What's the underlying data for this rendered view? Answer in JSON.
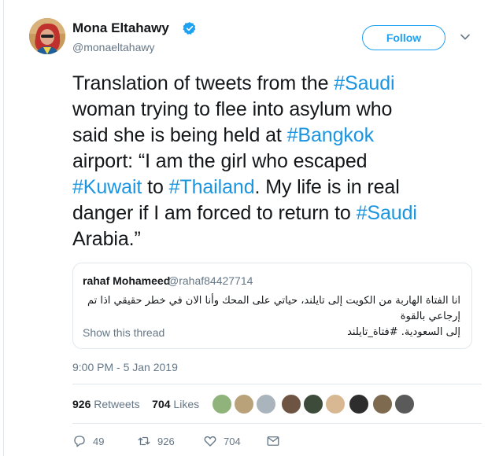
{
  "author": {
    "name": "Mona Eltahawy",
    "handle": "@monaeltahawy",
    "verified_icon": "verified-badge-icon"
  },
  "follow_button": {
    "label": "Follow"
  },
  "tweet": {
    "lines": [
      [
        {
          "t": "Translation of tweets from the "
        },
        {
          "t": "#Saudi",
          "tag": true
        }
      ],
      [
        {
          "t": "woman trying to flee into asylum who"
        }
      ],
      [
        {
          "t": "said she is being held at "
        },
        {
          "t": "#Bangkok",
          "tag": true
        }
      ],
      [
        {
          "t": "airport: “I am the girl who escaped"
        }
      ],
      [
        {
          "t": "#Kuwait",
          "tag": true
        },
        {
          "t": " to "
        },
        {
          "t": "#Thailand",
          "tag": true
        },
        {
          "t": ". My life is in real"
        }
      ],
      [
        {
          "t": "danger if I am forced to return to "
        },
        {
          "t": "#Saudi",
          "tag": true
        }
      ],
      [
        {
          "t": "Arabia.”"
        }
      ]
    ]
  },
  "quoted": {
    "name": "rahaf Mohameed",
    "handle": "@rahaf84427714",
    "body_line1": "انا الفتاة الهاربة من الكويت إلى تايلند، حياتي على المحك وأنا الان في خطر حقيقي اذا تم إرجاعي بالقوة",
    "body_line2": "إلى السعودية. #فتاة_تايلند",
    "show_thread": "Show this thread"
  },
  "timestamp": "9:00 PM - 5 Jan 2019",
  "stats": {
    "retweets_count": "926",
    "retweets_label": "Retweets",
    "likes_count": "704",
    "likes_label": "Likes"
  },
  "actions": {
    "reply_count": "49",
    "retweet_count": "926",
    "like_count": "704"
  },
  "colors": {
    "accent": "#1da1f2",
    "hashtag": "#1b95e0",
    "muted": "#657786",
    "border": "#e1e8ed"
  }
}
